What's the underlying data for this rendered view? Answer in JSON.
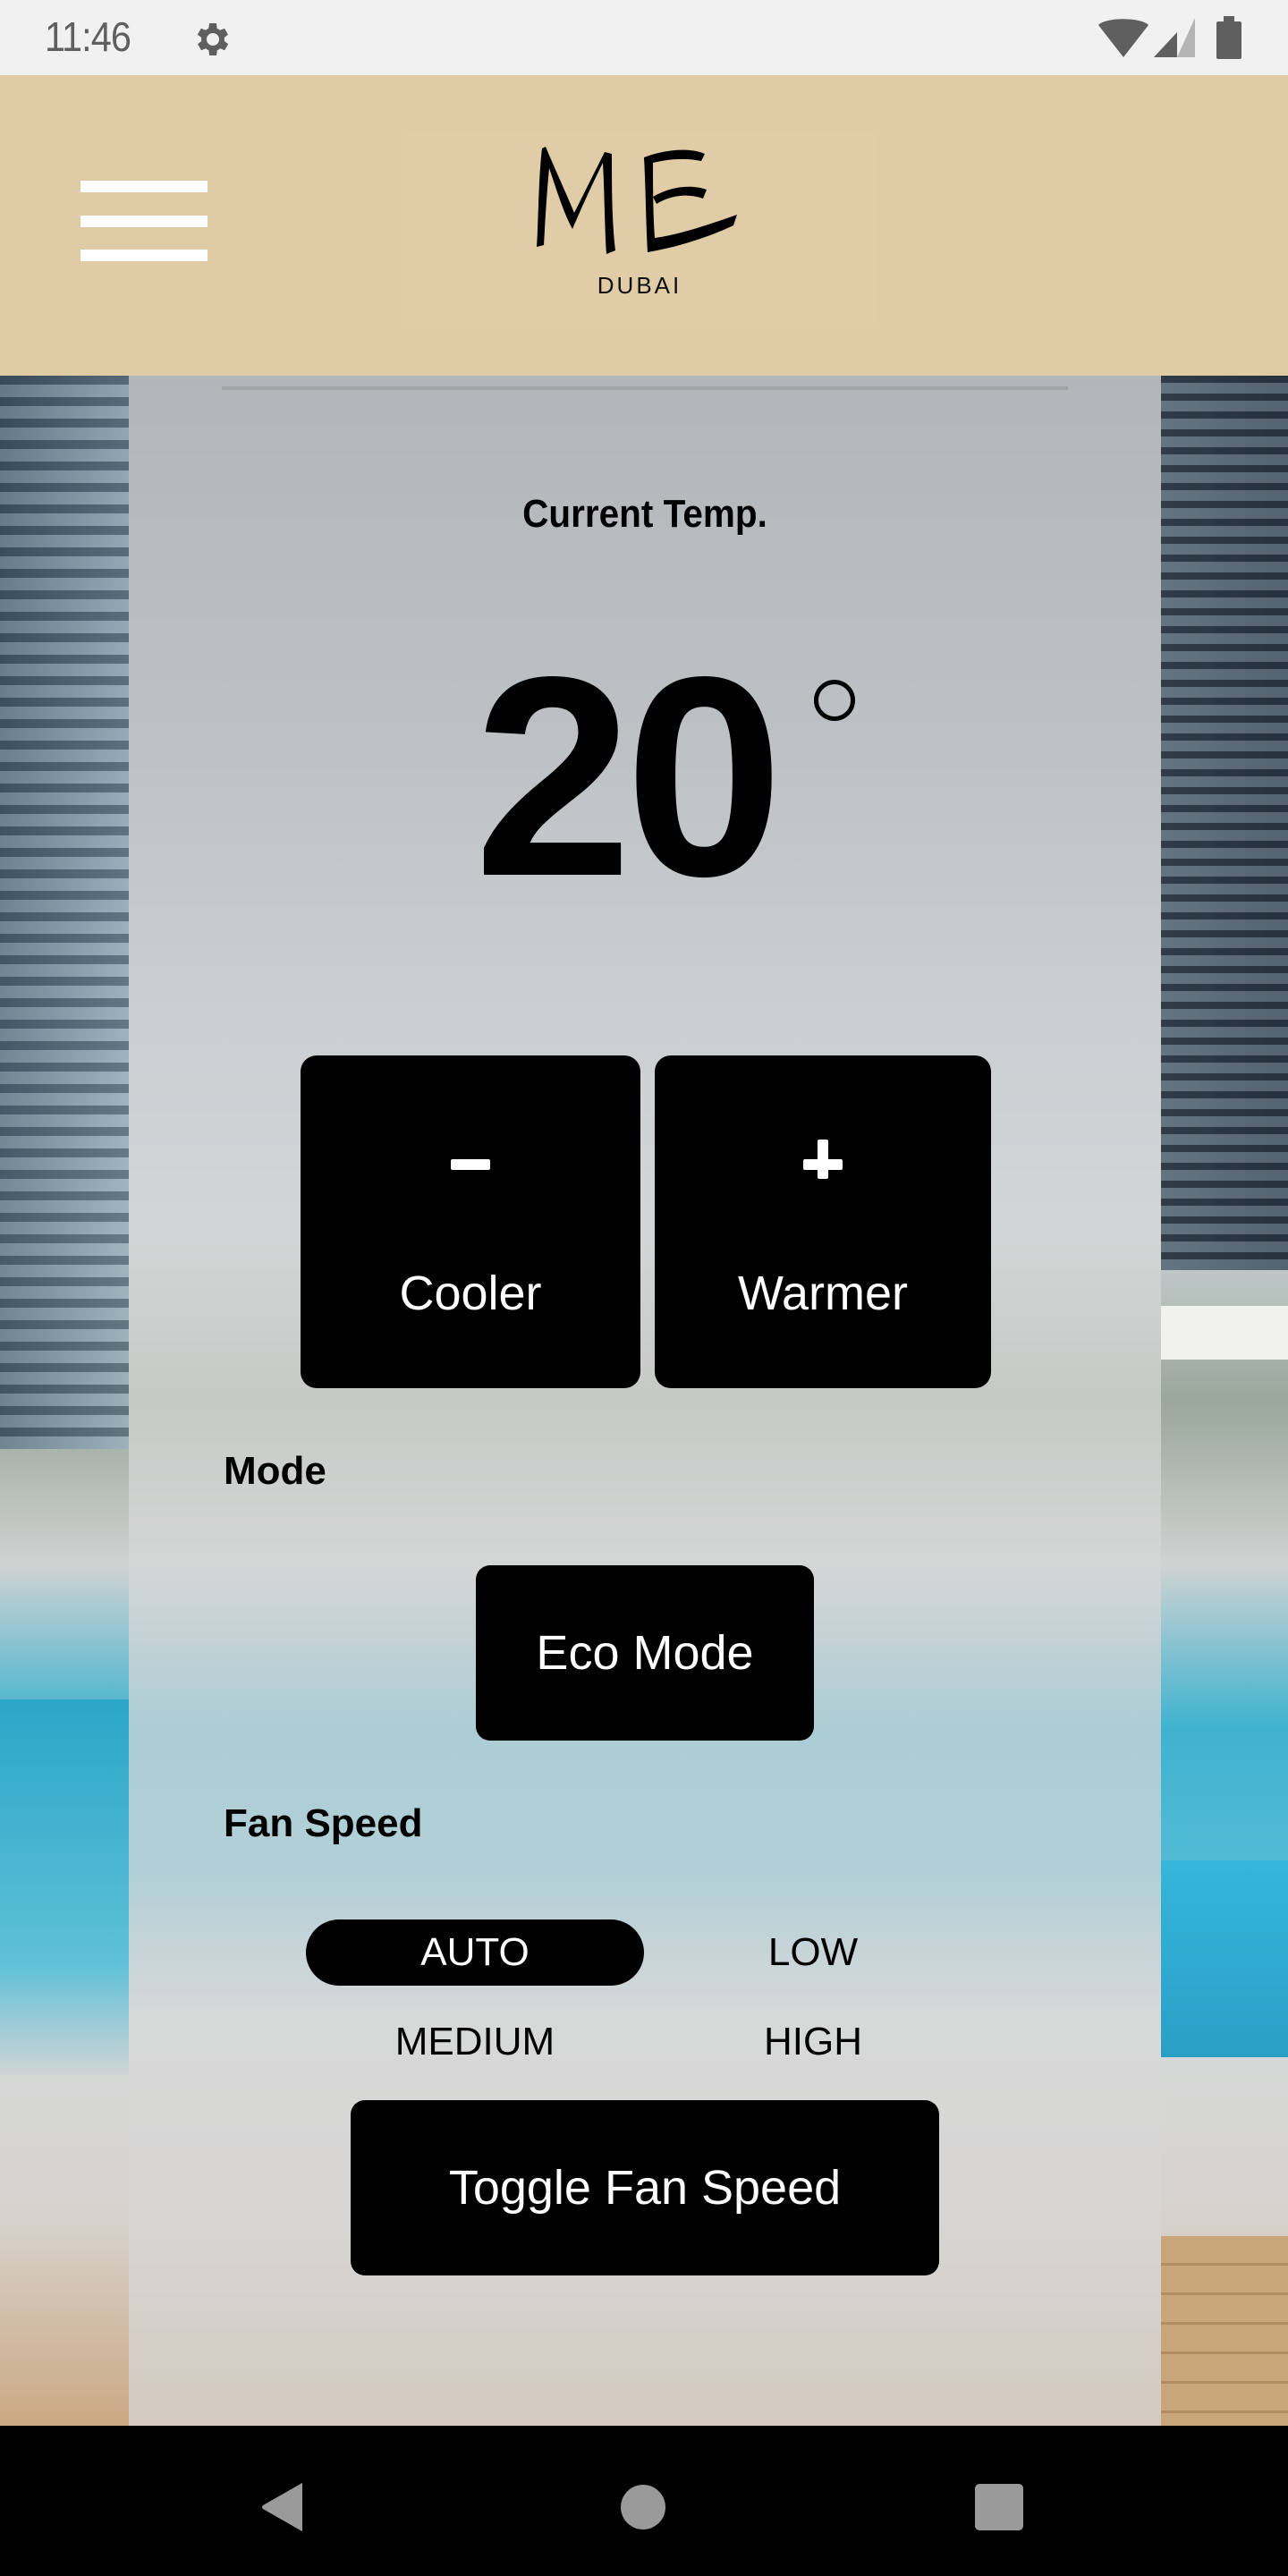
{
  "status_bar": {
    "time": "11:46",
    "icons": [
      "gear-icon",
      "wifi-icon",
      "cell-signal-icon",
      "battery-icon"
    ]
  },
  "header": {
    "menu_icon": "hamburger-menu-icon",
    "logo_text": "ME",
    "logo_subtitle": "DUBAI"
  },
  "thermostat": {
    "current_label": "Current Temp.",
    "temperature": "20",
    "unit_symbol": "°",
    "cooler": {
      "symbol": "−",
      "label": "Cooler"
    },
    "warmer": {
      "symbol": "+",
      "label": "Warmer"
    }
  },
  "mode": {
    "label": "Mode",
    "button_label": "Eco Mode"
  },
  "fan_speed": {
    "label": "Fan Speed",
    "options": [
      "AUTO",
      "LOW",
      "MEDIUM",
      "HIGH"
    ],
    "selected": "AUTO",
    "toggle_label": "Toggle Fan Speed"
  },
  "colors": {
    "header_bg": "#dfcba4",
    "button_bg": "#000000",
    "button_text": "#ffffff",
    "panel_overlay": "rgba(215,215,215,0.72)"
  },
  "nav_bar": {
    "buttons": [
      "back-icon",
      "home-icon",
      "recents-icon"
    ]
  }
}
